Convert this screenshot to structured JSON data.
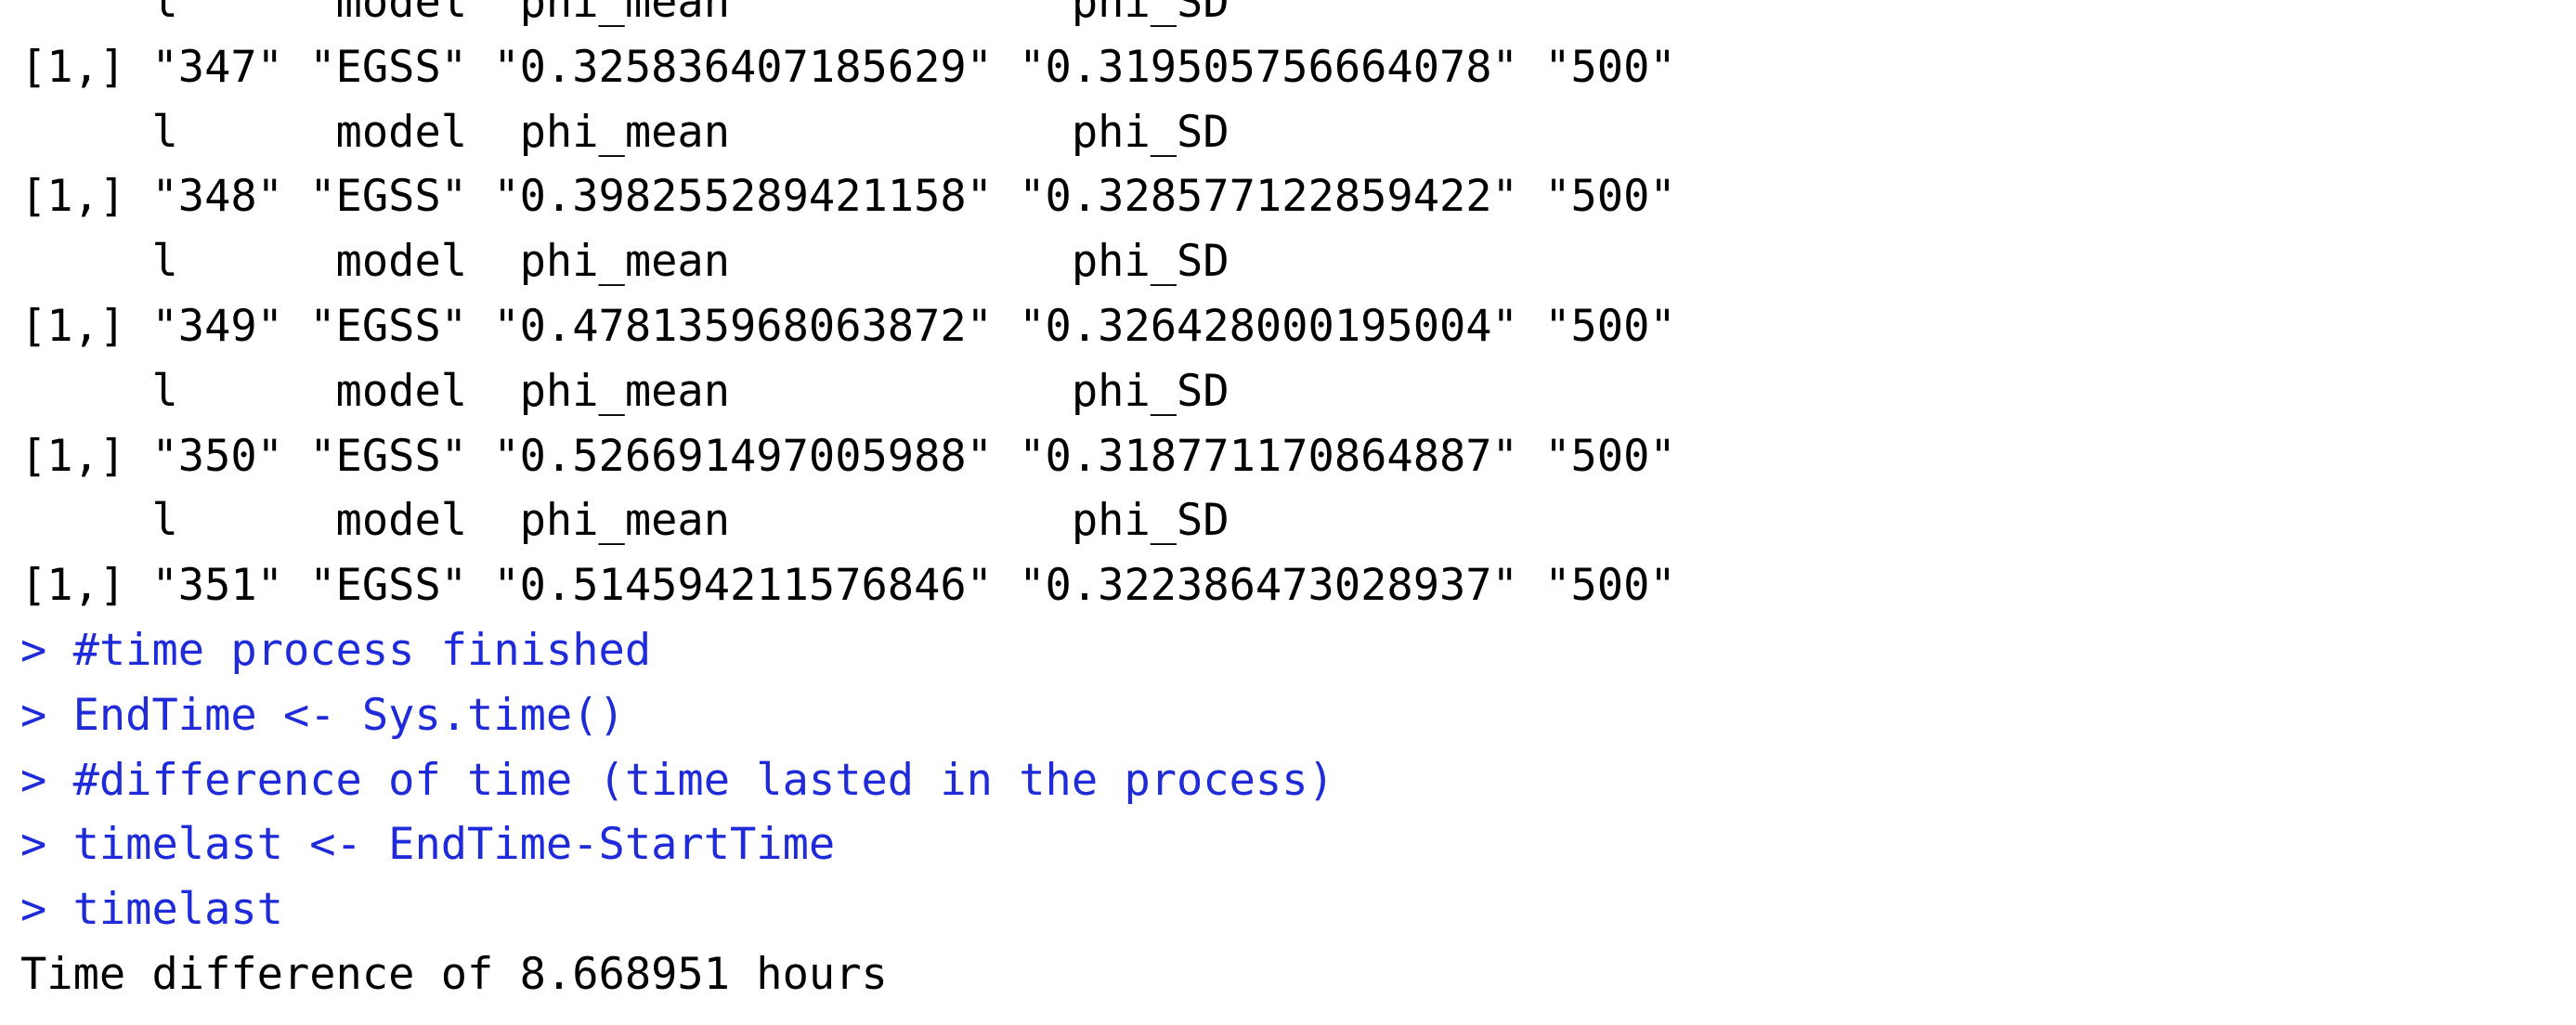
{
  "console": {
    "lines": [
      {
        "kind": "output",
        "text": "     l      model  phi_mean             phi_SD"
      },
      {
        "kind": "output",
        "text": "[1,] \"347\" \"EGSS\" \"0.325836407185629\" \"0.319505756664078\" \"500\""
      },
      {
        "kind": "output",
        "text": "     l      model  phi_mean             phi_SD"
      },
      {
        "kind": "output",
        "text": "[1,] \"348\" \"EGSS\" \"0.398255289421158\" \"0.328577122859422\" \"500\""
      },
      {
        "kind": "output",
        "text": "     l      model  phi_mean             phi_SD"
      },
      {
        "kind": "output",
        "text": "[1,] \"349\" \"EGSS\" \"0.478135968063872\" \"0.326428000195004\" \"500\""
      },
      {
        "kind": "output",
        "text": "     l      model  phi_mean             phi_SD"
      },
      {
        "kind": "output",
        "text": "[1,] \"350\" \"EGSS\" \"0.526691497005988\" \"0.318771170864887\" \"500\""
      },
      {
        "kind": "output",
        "text": "     l      model  phi_mean             phi_SD"
      },
      {
        "kind": "output",
        "text": "[1,] \"351\" \"EGSS\" \"0.514594211576846\" \"0.322386473028937\" \"500\""
      },
      {
        "kind": "command",
        "text": "> #time process finished"
      },
      {
        "kind": "command",
        "text": "> EndTime <- Sys.time()"
      },
      {
        "kind": "command",
        "text": "> #difference of time (time lasted in the process)"
      },
      {
        "kind": "command",
        "text": "> timelast <- EndTime-StartTime"
      },
      {
        "kind": "command",
        "text": "> timelast"
      },
      {
        "kind": "output",
        "text": "Time difference of 8.668951 hours"
      }
    ]
  },
  "colors": {
    "command": "#1f2bd8",
    "output": "#000000",
    "background": "#ffffff"
  }
}
